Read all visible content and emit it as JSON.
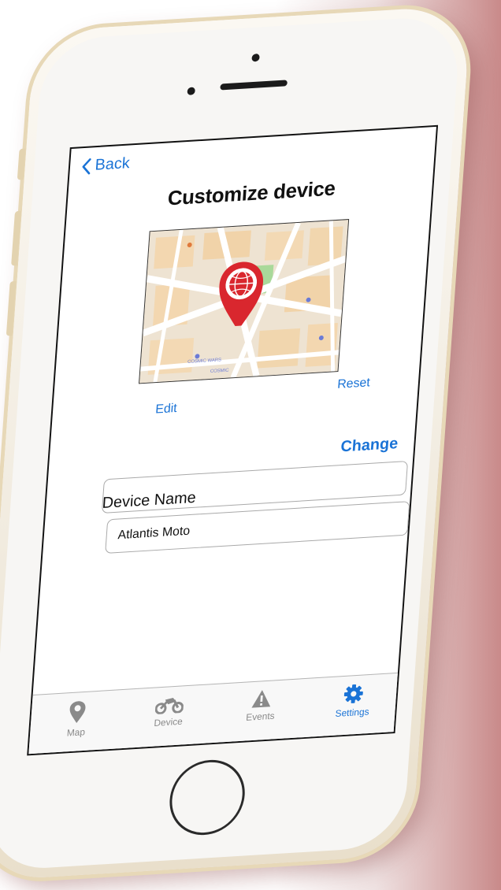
{
  "nav": {
    "back_label": "Back"
  },
  "page": {
    "title": "Customize device"
  },
  "map": {
    "edit_label": "Edit",
    "reset_label": "Reset",
    "place_labels": [
      "COSMIC WARS",
      "COSMIC"
    ],
    "marker_color": "#d9272e"
  },
  "device": {
    "change_label": "Change",
    "name_label": "Device Name",
    "name_value": "Atlantis Moto"
  },
  "tabs": [
    {
      "label": "Map",
      "icon": "map-pin-icon",
      "active": false
    },
    {
      "label": "Device",
      "icon": "motorcycle-icon",
      "active": false
    },
    {
      "label": "Events",
      "icon": "warning-icon",
      "active": false
    },
    {
      "label": "Settings",
      "icon": "gear-icon",
      "active": true
    }
  ],
  "colors": {
    "accent": "#1a73d6",
    "inactive_tab": "#8a8a8a"
  }
}
